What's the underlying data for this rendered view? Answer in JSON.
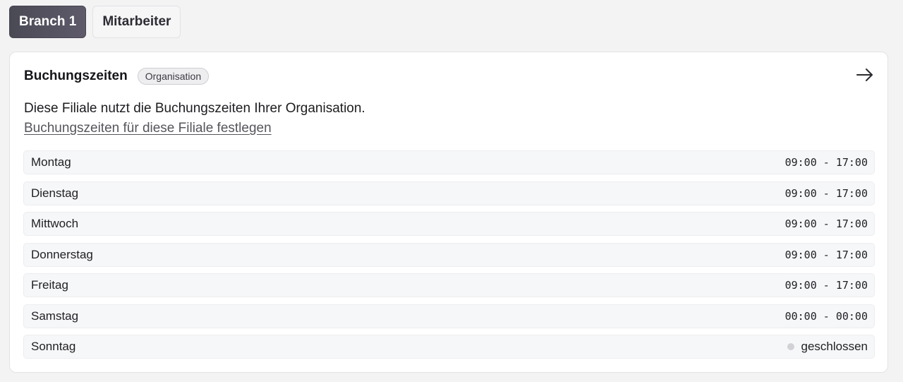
{
  "tabs": [
    {
      "label": "Branch 1",
      "active": true
    },
    {
      "label": "Mitarbeiter",
      "active": false
    }
  ],
  "card": {
    "title": "Buchungszeiten",
    "badge": "Organisation",
    "arrow_icon": "arrow-right-icon",
    "description": "Diese Filiale nutzt die Buchungszeiten Ihrer Organisation.",
    "link": "Buchungszeiten für diese Filiale festlegen"
  },
  "days": [
    {
      "name": "Montag",
      "hours": "09:00 - 17:00"
    },
    {
      "name": "Dienstag",
      "hours": "09:00 - 17:00"
    },
    {
      "name": "Mittwoch",
      "hours": "09:00 - 17:00"
    },
    {
      "name": "Donnerstag",
      "hours": "09:00 - 17:00"
    },
    {
      "name": "Freitag",
      "hours": "09:00 - 17:00"
    },
    {
      "name": "Samstag",
      "hours": "00:00 - 00:00"
    },
    {
      "name": "Sonntag",
      "closed_label": "geschlossen"
    }
  ],
  "colors": {
    "active_tab": "#4a4a55",
    "closed_dot": "#d2d2d6"
  }
}
